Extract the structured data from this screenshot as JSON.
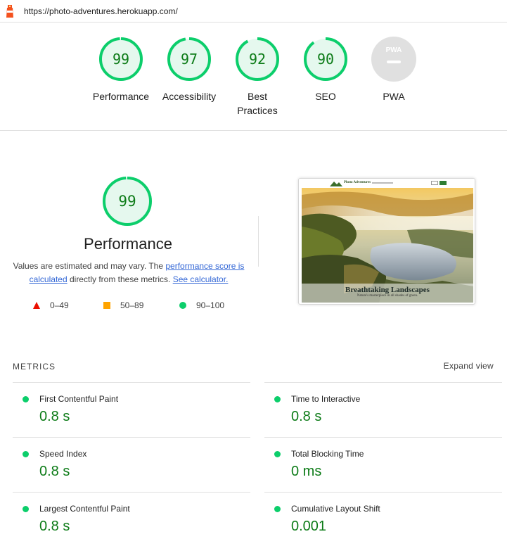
{
  "url": "https://photo-adventures.herokuapp.com/",
  "gauges": [
    {
      "label": "Performance",
      "score": "99",
      "fraction": 0.99
    },
    {
      "label": "Accessibility",
      "score": "97",
      "fraction": 0.97
    },
    {
      "label": "Best Practices",
      "score": "92",
      "fraction": 0.92
    },
    {
      "label": "SEO",
      "score": "90",
      "fraction": 0.9
    },
    {
      "label": "PWA",
      "score": "",
      "fraction": 0
    }
  ],
  "pwa_badge_text": "PWA",
  "performance": {
    "score": "99",
    "fraction": 0.99,
    "title": "Performance",
    "desc_prefix": "Values are estimated and may vary. The ",
    "link1": "performance score is calculated",
    "desc_middle": " directly from these metrics. ",
    "link2": "See calculator."
  },
  "legend": [
    {
      "range": "0–49",
      "shape": "triangle",
      "color": "#eb0f00"
    },
    {
      "range": "50–89",
      "shape": "square",
      "color": "#ffa400"
    },
    {
      "range": "90–100",
      "shape": "circle",
      "color": "#0cce6b"
    }
  ],
  "thumbnail": {
    "logo": "Photo Adventures",
    "heading": "Breathtaking Landscapes",
    "subheading": "Nature's masterpiece in all shades of green."
  },
  "metrics_header": "METRICS",
  "expand_view": "Expand view",
  "metrics": [
    {
      "name": "First Contentful Paint",
      "value": "0.8 s"
    },
    {
      "name": "Time to Interactive",
      "value": "0.8 s"
    },
    {
      "name": "Speed Index",
      "value": "0.8 s"
    },
    {
      "name": "Total Blocking Time",
      "value": "0 ms"
    },
    {
      "name": "Largest Contentful Paint",
      "value": "0.8 s"
    },
    {
      "name": "Cumulative Layout Shift",
      "value": "0.001"
    }
  ],
  "colors": {
    "pass": "#0cce6b",
    "pass_text": "#0c7b17",
    "pass_bg": "#e5f8ee",
    "link": "#3367d6",
    "pwa_gray": "#e0e0e0"
  }
}
